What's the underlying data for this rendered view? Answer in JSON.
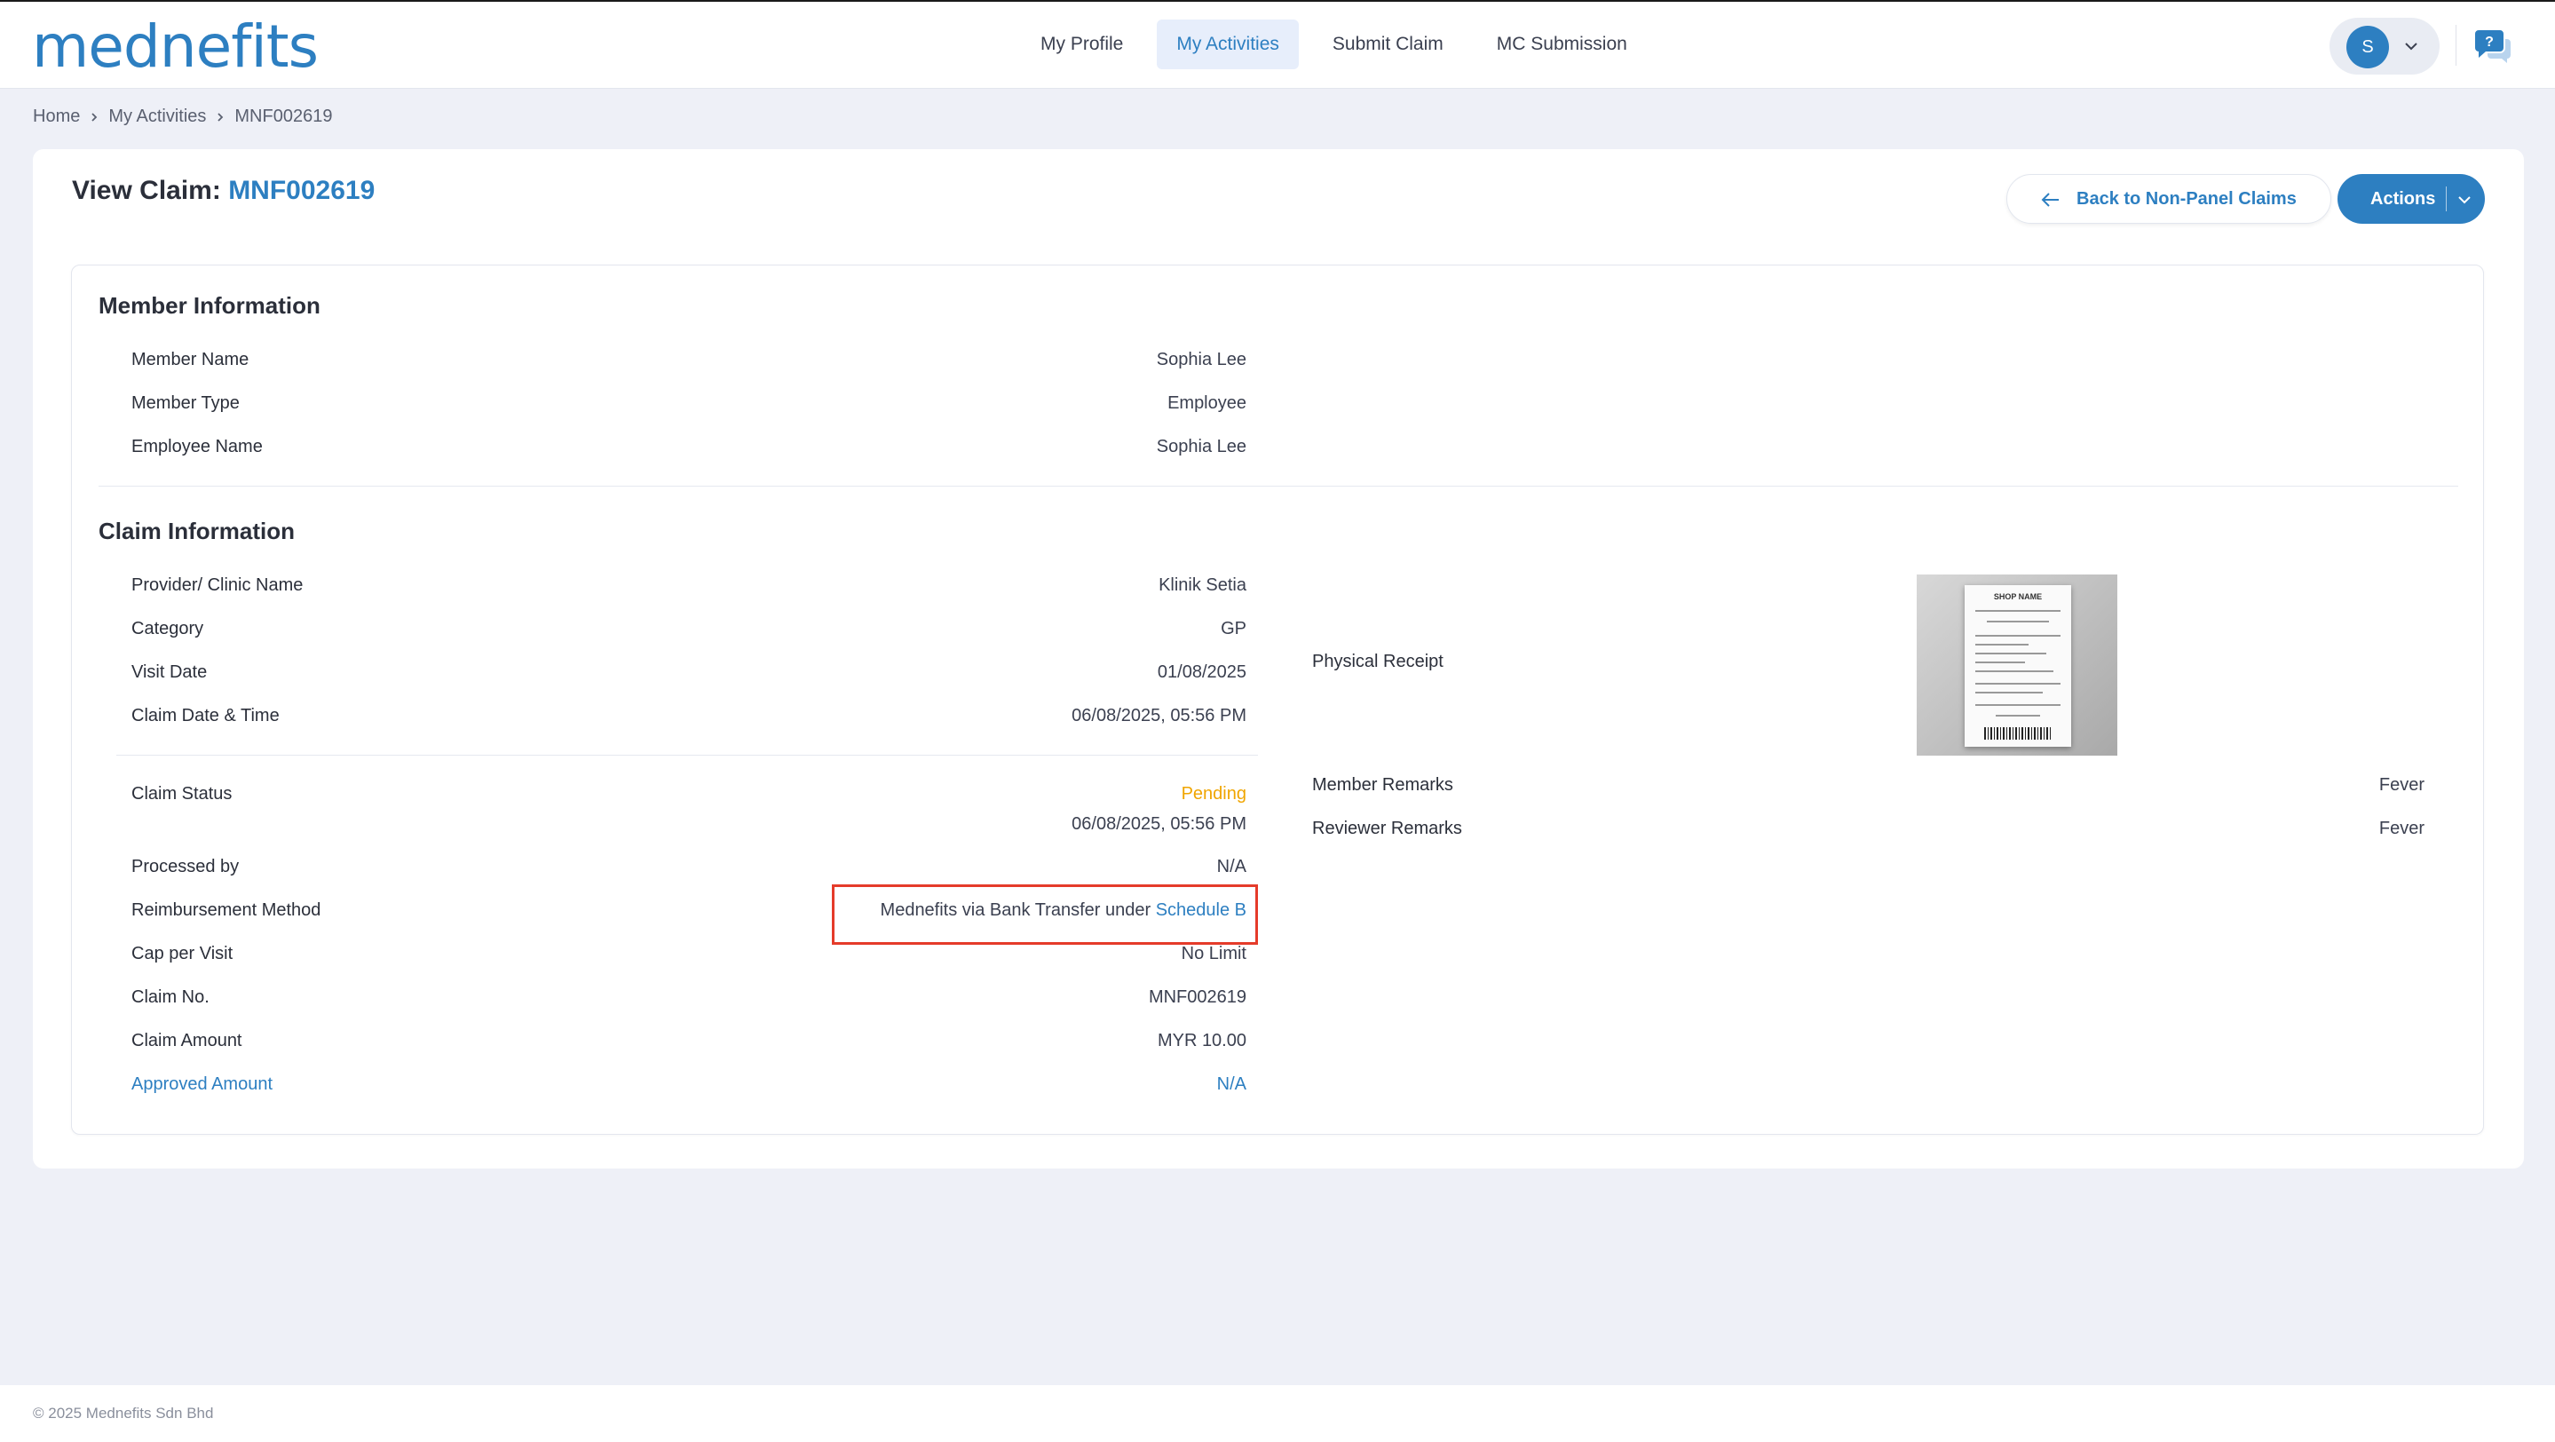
{
  "brand": {
    "logo_text": "mednefits"
  },
  "nav": {
    "items": [
      {
        "label": "My Profile",
        "active": false
      },
      {
        "label": "My Activities",
        "active": true
      },
      {
        "label": "Submit Claim",
        "active": false
      },
      {
        "label": "MC Submission",
        "active": false
      }
    ]
  },
  "user": {
    "initial": "S"
  },
  "breadcrumb": [
    "Home",
    "My Activities",
    "MNF002619"
  ],
  "page": {
    "title_prefix": "View Claim:",
    "claim_id": "MNF002619",
    "back_label": "Back to Non-Panel Claims",
    "actions_label": "Actions"
  },
  "member_info": {
    "title": "Member Information",
    "rows": [
      {
        "label": "Member Name",
        "value": "Sophia Lee"
      },
      {
        "label": "Member Type",
        "value": "Employee"
      },
      {
        "label": "Employee Name",
        "value": "Sophia Lee"
      }
    ]
  },
  "claim_info": {
    "title": "Claim Information",
    "rows": [
      {
        "label": "Provider/ Clinic Name",
        "value": "Klinik Setia"
      },
      {
        "label": "Category",
        "value": "GP"
      },
      {
        "label": "Visit Date",
        "value": "01/08/2025"
      },
      {
        "label": "Claim Date & Time",
        "value": "06/08/2025, 05:56 PM"
      }
    ],
    "status": {
      "label": "Claim Status",
      "value": "Pending",
      "datetime": "06/08/2025, 05:56 PM"
    },
    "processed_by": {
      "label": "Processed by",
      "value": "N/A"
    },
    "reimbursement": {
      "label": "Reimbursement Method",
      "value_prefix": "Mednefits via Bank Transfer under",
      "link": "Schedule B"
    },
    "rows2": [
      {
        "label": "Cap per Visit",
        "value": "No Limit"
      },
      {
        "label": "Claim No.",
        "value": "MNF002619"
      },
      {
        "label": "Claim Amount",
        "value": "MYR 10.00"
      }
    ],
    "approved": {
      "label": "Approved Amount",
      "value": "N/A"
    },
    "receipt": {
      "label": "Physical Receipt",
      "shop_name": "SHOP NAME"
    },
    "remarks": [
      {
        "label": "Member Remarks",
        "value": "Fever"
      },
      {
        "label": "Reviewer Remarks",
        "value": "Fever"
      }
    ]
  },
  "colors": {
    "brand": "#2d7fc1",
    "pending": "#f0a500",
    "highlight": "#e53b2a"
  },
  "footer": {
    "copyright": "© 2025 Mednefits Sdn Bhd"
  }
}
